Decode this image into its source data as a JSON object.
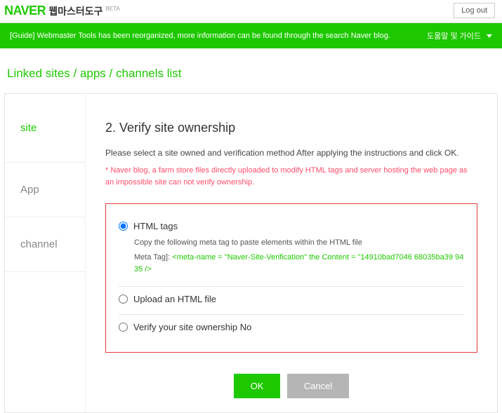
{
  "header": {
    "logo": "NAVER",
    "logo_sub": "웹마스터도구",
    "beta": "BETA",
    "logout": "Log out"
  },
  "banner": {
    "text": "[Guide] Webmaster Tools has been reorganized, more information can be found through the search Naver blog.",
    "right": "도움말 및 가이드"
  },
  "breadcrumb": "Linked sites / apps / channels list",
  "sidebar": {
    "tabs": [
      {
        "label": "site"
      },
      {
        "label": "App"
      },
      {
        "label": "channel"
      }
    ]
  },
  "verify": {
    "title": "2. Verify site ownership",
    "instruction": "Please select a site owned and verification method After applying the instructions and click OK.",
    "warning": "* Naver blog, a farm store files directly uploaded to modify HTML tags and server hosting the web page as an impossible site can not verify ownership.",
    "options": [
      {
        "label": "HTML tags",
        "desc": "Copy the following meta tag to paste elements within the HTML file",
        "meta_label": "Meta Tag]:",
        "meta_value": "<meta-name = \"Naver-Site-Verification\" the Content = \"14910bad7046      68035ba39          9435       />"
      },
      {
        "label": "Upload an HTML file"
      },
      {
        "label": "Verify your site ownership No"
      }
    ],
    "ok": "OK",
    "cancel": "Cancel"
  }
}
